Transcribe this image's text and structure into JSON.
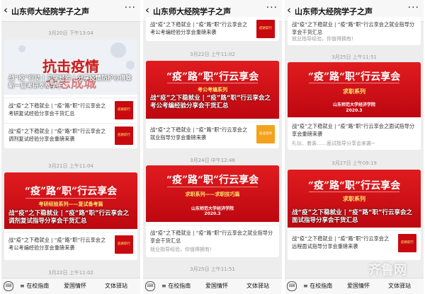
{
  "account_title": "山东师大经院学子之声",
  "footer": {
    "menu1": "在校指南",
    "menu2": "爱国情怀",
    "menu3": "文体驿站"
  },
  "panel1": {
    "ts1": "3月20日 下午13:04",
    "cover1": {
      "big": "抗击疫情",
      "big2": "众志成城"
    },
    "headline1": "战“疫”行动 | 见学经验 | 分享疫情防护心得致新一届考研莘莘学子",
    "row1": "战“疫”之下稳就业 | “疫”路“职”行云享会之考研复试经验分享会干货汇总",
    "row2": "战“疫”之下稳就业 | “疫”路“职”行云享会之调剂复试经验分享会重磅来袭",
    "ts2": "3月21日 上午11:04",
    "cover2": {
      "big": "“疫”路“职”行云享会",
      "small": "考研经验系列——复试备考篇"
    },
    "headline2": "战“疫”之下稳就业 | “疫”路“职”行云享会之调剂复试指导分享会干货汇总",
    "row3": "战“疫”之下稳就业 | “疫”路“职”行云享会之考公考编经验分享会重磅来袭",
    "ts3": "3月22日 上午11:02"
  },
  "panel2": {
    "top_row": "战“疫”之下稳就业 | “疫”路“职”行云享会之考公考编经验分享会重磅来袭",
    "ts1": "3月22日 上午11:02",
    "cover1": {
      "big": "“疫”路“职”行云享会",
      "small": "考公考编系列"
    },
    "headline1": "战“疫”之下稳就业 | “疫”路“职”行云享会之考公考编经验分享会干货汇总",
    "row1": "战“疫”之下稳就业 | “疫”路“职”行云享会之就业指导分享会重磅来袭",
    "ts2": "3月24日 中午12:48",
    "cover2": {
      "big": "“疫”路“职”行云享会",
      "small": "求职系列——求职技巧篇",
      "org": "山东师范大学经济学院",
      "year": "2020.3"
    },
    "row2": "战“疫”之下稳就业 | “疫”路“职”行云享会之就业指导分享会干货汇总",
    "sub2": "就业指导经验，你值得拥有!",
    "ts3": "3月25日 上午11:51"
  },
  "panel3": {
    "top_row": "战“疫”之下稳就业 | “疫”路“职”行云享会之就业指导分享会干货汇总",
    "top_sub": "就业指导经验，你值得拥有!",
    "ts1": "3月25日 上午11:51",
    "cover1": {
      "big": "“疫”路“职”行云享会",
      "small": "求职系列",
      "org": "山东师范大学经济学院",
      "year": "2020.3"
    },
    "headline1": "战“疫”之下稳就业 | “疫”路“职”行云享会之面试指导分享会重磅来袭",
    "sub1": "礼仪、着装……面试指导分享会来袭~",
    "ts2": "3月27日 上午09:19",
    "cover2": {
      "big": "“疫”路“职”行云享会",
      "small": "求职系列"
    },
    "headline2": "战“疫”之下稳就业 | “疫”路“职”行云享会之面试指导分享会干货汇总",
    "row2": "战“疫”之下稳就业 | “疫”路“职”行云享会之远程面试指导分享会重磅来袭",
    "watermark": "齐鲁网"
  },
  "icons": [
    "back-arrow-icon",
    "more-dots-icon",
    "keyboard-icon"
  ],
  "colors": {
    "brand_red": "#c80a10",
    "bg": "#ededed"
  }
}
